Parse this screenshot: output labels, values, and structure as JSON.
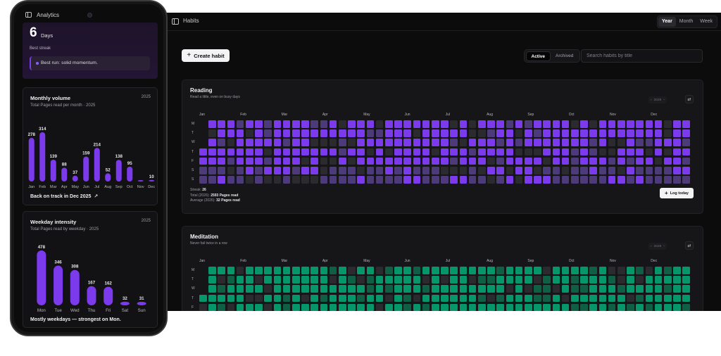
{
  "desktop": {
    "title": "Habits",
    "view_options": [
      "Year",
      "Month",
      "Week"
    ],
    "selected_view": "Year",
    "create_label": "Create habit",
    "status_options": [
      "Active",
      "Archived"
    ],
    "selected_status": "Active",
    "search_placeholder": "Search habits by title",
    "month_labels": [
      "Jan",
      "Feb",
      "Mar",
      "Apr",
      "May",
      "Jun",
      "Jul",
      "Aug",
      "Sep",
      "Oct",
      "Nov",
      "Dec"
    ],
    "weekday_labels": [
      "M",
      "T",
      "W",
      "T",
      "F",
      "S",
      "S"
    ],
    "habits": [
      {
        "name": "Reading",
        "description": "Read a little, even on busy days",
        "year": "2026",
        "color": "#7c3aed",
        "partial_color": "#4c3a7a",
        "empty_color": "#2b2b2f",
        "streak_label": "Streak:",
        "streak_value": "26",
        "total_label": "Total (2026):",
        "total_value": "2593 Pages read",
        "average_label": "Average (2026):",
        "average_value": "32 Pages read",
        "log_label": "Log today"
      },
      {
        "name": "Meditation",
        "description": "Never fail twice in a row",
        "year": "2026",
        "color": "#059669",
        "partial_color": "#0f5f45",
        "empty_color": "#2b2b2f"
      }
    ]
  },
  "phone": {
    "title": "Analytics",
    "streak": {
      "value": "6",
      "unit": "Days",
      "label": "Best streak",
      "note": "Best run: solid momentum."
    },
    "monthly": {
      "title": "Monthly volume",
      "year": "2025",
      "subtitle": "Total Pages read per month · 2025",
      "footer": "Back on track in Dec 2025",
      "footer_icon": "trending-up-icon"
    },
    "weekday": {
      "title": "Weekday intensity",
      "year": "2025",
      "subtitle": "Total Pages read by weekday · 2025",
      "footer": "Mostly weekdays — strongest on Mon."
    }
  },
  "chart_data": [
    {
      "type": "bar",
      "title": "Monthly volume",
      "categories": [
        "Jan",
        "Feb",
        "Mar",
        "Apr",
        "May",
        "Jun",
        "Jul",
        "Aug",
        "Sep",
        "Oct",
        "Nov",
        "Dec"
      ],
      "values": [
        278,
        314,
        139,
        88,
        37,
        159,
        214,
        52,
        138,
        95,
        0,
        10
      ],
      "color": "#7c3aed"
    },
    {
      "type": "bar",
      "title": "Weekday intensity",
      "categories": [
        "Mon",
        "Tue",
        "Wed",
        "Thu",
        "Fri",
        "Sat",
        "Sun"
      ],
      "values": [
        478,
        346,
        308,
        167,
        162,
        32,
        31
      ],
      "color": "#7c3aed"
    }
  ]
}
